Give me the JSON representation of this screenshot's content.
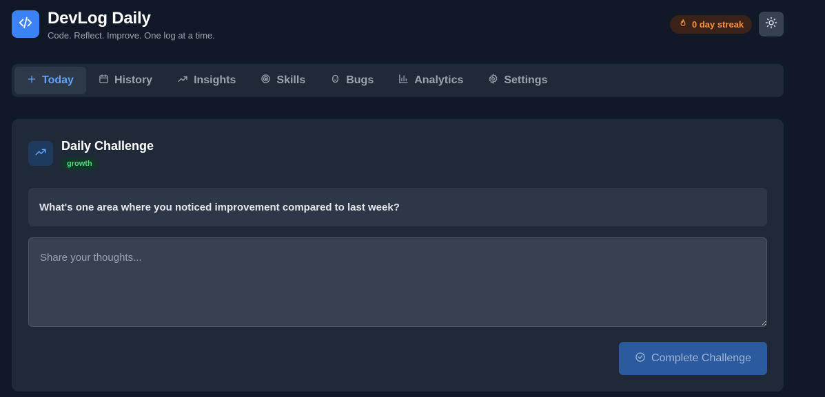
{
  "header": {
    "title": "DevLog Daily",
    "subtitle": "Code. Reflect. Improve. One log at a time.",
    "logo_icon": "code-icon",
    "streak_label": "0 day streak",
    "streak_icon": "flame-icon",
    "theme_icon": "sun-icon"
  },
  "nav": {
    "items": [
      {
        "label": "Today",
        "icon": "plus-icon",
        "active": true
      },
      {
        "label": "History",
        "icon": "calendar-icon"
      },
      {
        "label": "Insights",
        "icon": "trending-up-icon"
      },
      {
        "label": "Skills",
        "icon": "target-icon"
      },
      {
        "label": "Bugs",
        "icon": "bug-icon"
      },
      {
        "label": "Analytics",
        "icon": "bar-chart-icon"
      },
      {
        "label": "Settings",
        "icon": "gear-icon"
      }
    ]
  },
  "challenge": {
    "title": "Daily Challenge",
    "tag": "growth",
    "icon": "trending-up-icon",
    "question": "What's one area where you noticed improvement compared to last week?",
    "answer_value": "",
    "answer_placeholder": "Share your thoughts...",
    "submit_label": "Complete Challenge",
    "submit_icon": "check-circle-icon"
  },
  "colors": {
    "background": "#111827",
    "surface": "#1f2937",
    "accent": "#3b82f6",
    "active_nav": "#60a5fa",
    "streak": "#fb923c",
    "tag": "#4ade80"
  }
}
